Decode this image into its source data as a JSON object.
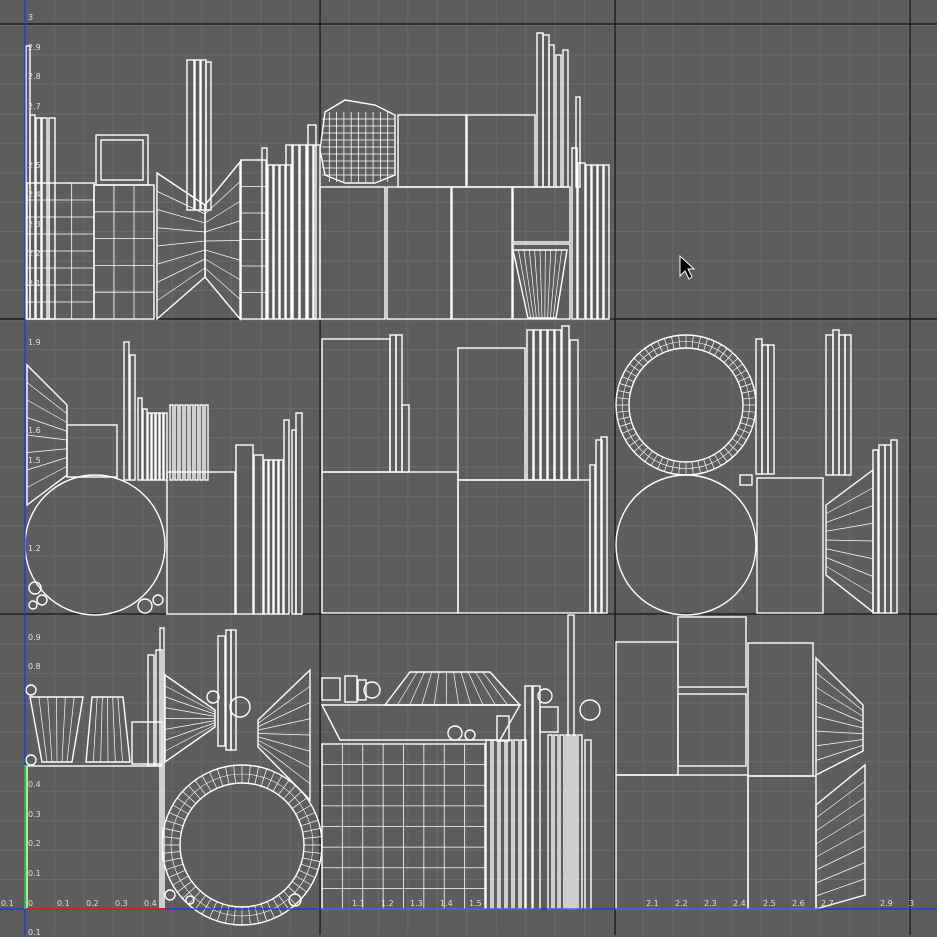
{
  "editor": {
    "view": "UV texture editor",
    "colors": {
      "background": "#5d5d5d",
      "minor_grid": "#6b6b6b",
      "major_grid": "#101010",
      "wireframe": "#ffffff",
      "u_axis": "#d02020",
      "v_axis": "#20c020",
      "origin_axis": "#2040ff"
    },
    "cursor_icon": "arrow-cursor-icon"
  },
  "ruler": {
    "u_ticks": [
      "0.1",
      "0",
      "0.1",
      "0.2",
      "0.3",
      "0.4",
      "1.1",
      "1.2",
      "1.3",
      "1.4",
      "1.5",
      "2.1",
      "2.2",
      "2.3",
      "2.4",
      "2.5",
      "2.6",
      "2.7",
      "2.9",
      "3"
    ],
    "v_ticks_top": [
      "3",
      "2.9",
      "2.8",
      "2.7",
      "2.5",
      "2.4",
      "2.3",
      "2.2",
      "2.1"
    ],
    "v_ticks_mid": [
      "1.9",
      "1.5",
      "1.2",
      "1.6"
    ],
    "v_ticks_low": [
      "0.9",
      "0.8",
      "0.4",
      "0.3",
      "0.2",
      "0.1"
    ],
    "v_tick_neg": "0.1"
  }
}
